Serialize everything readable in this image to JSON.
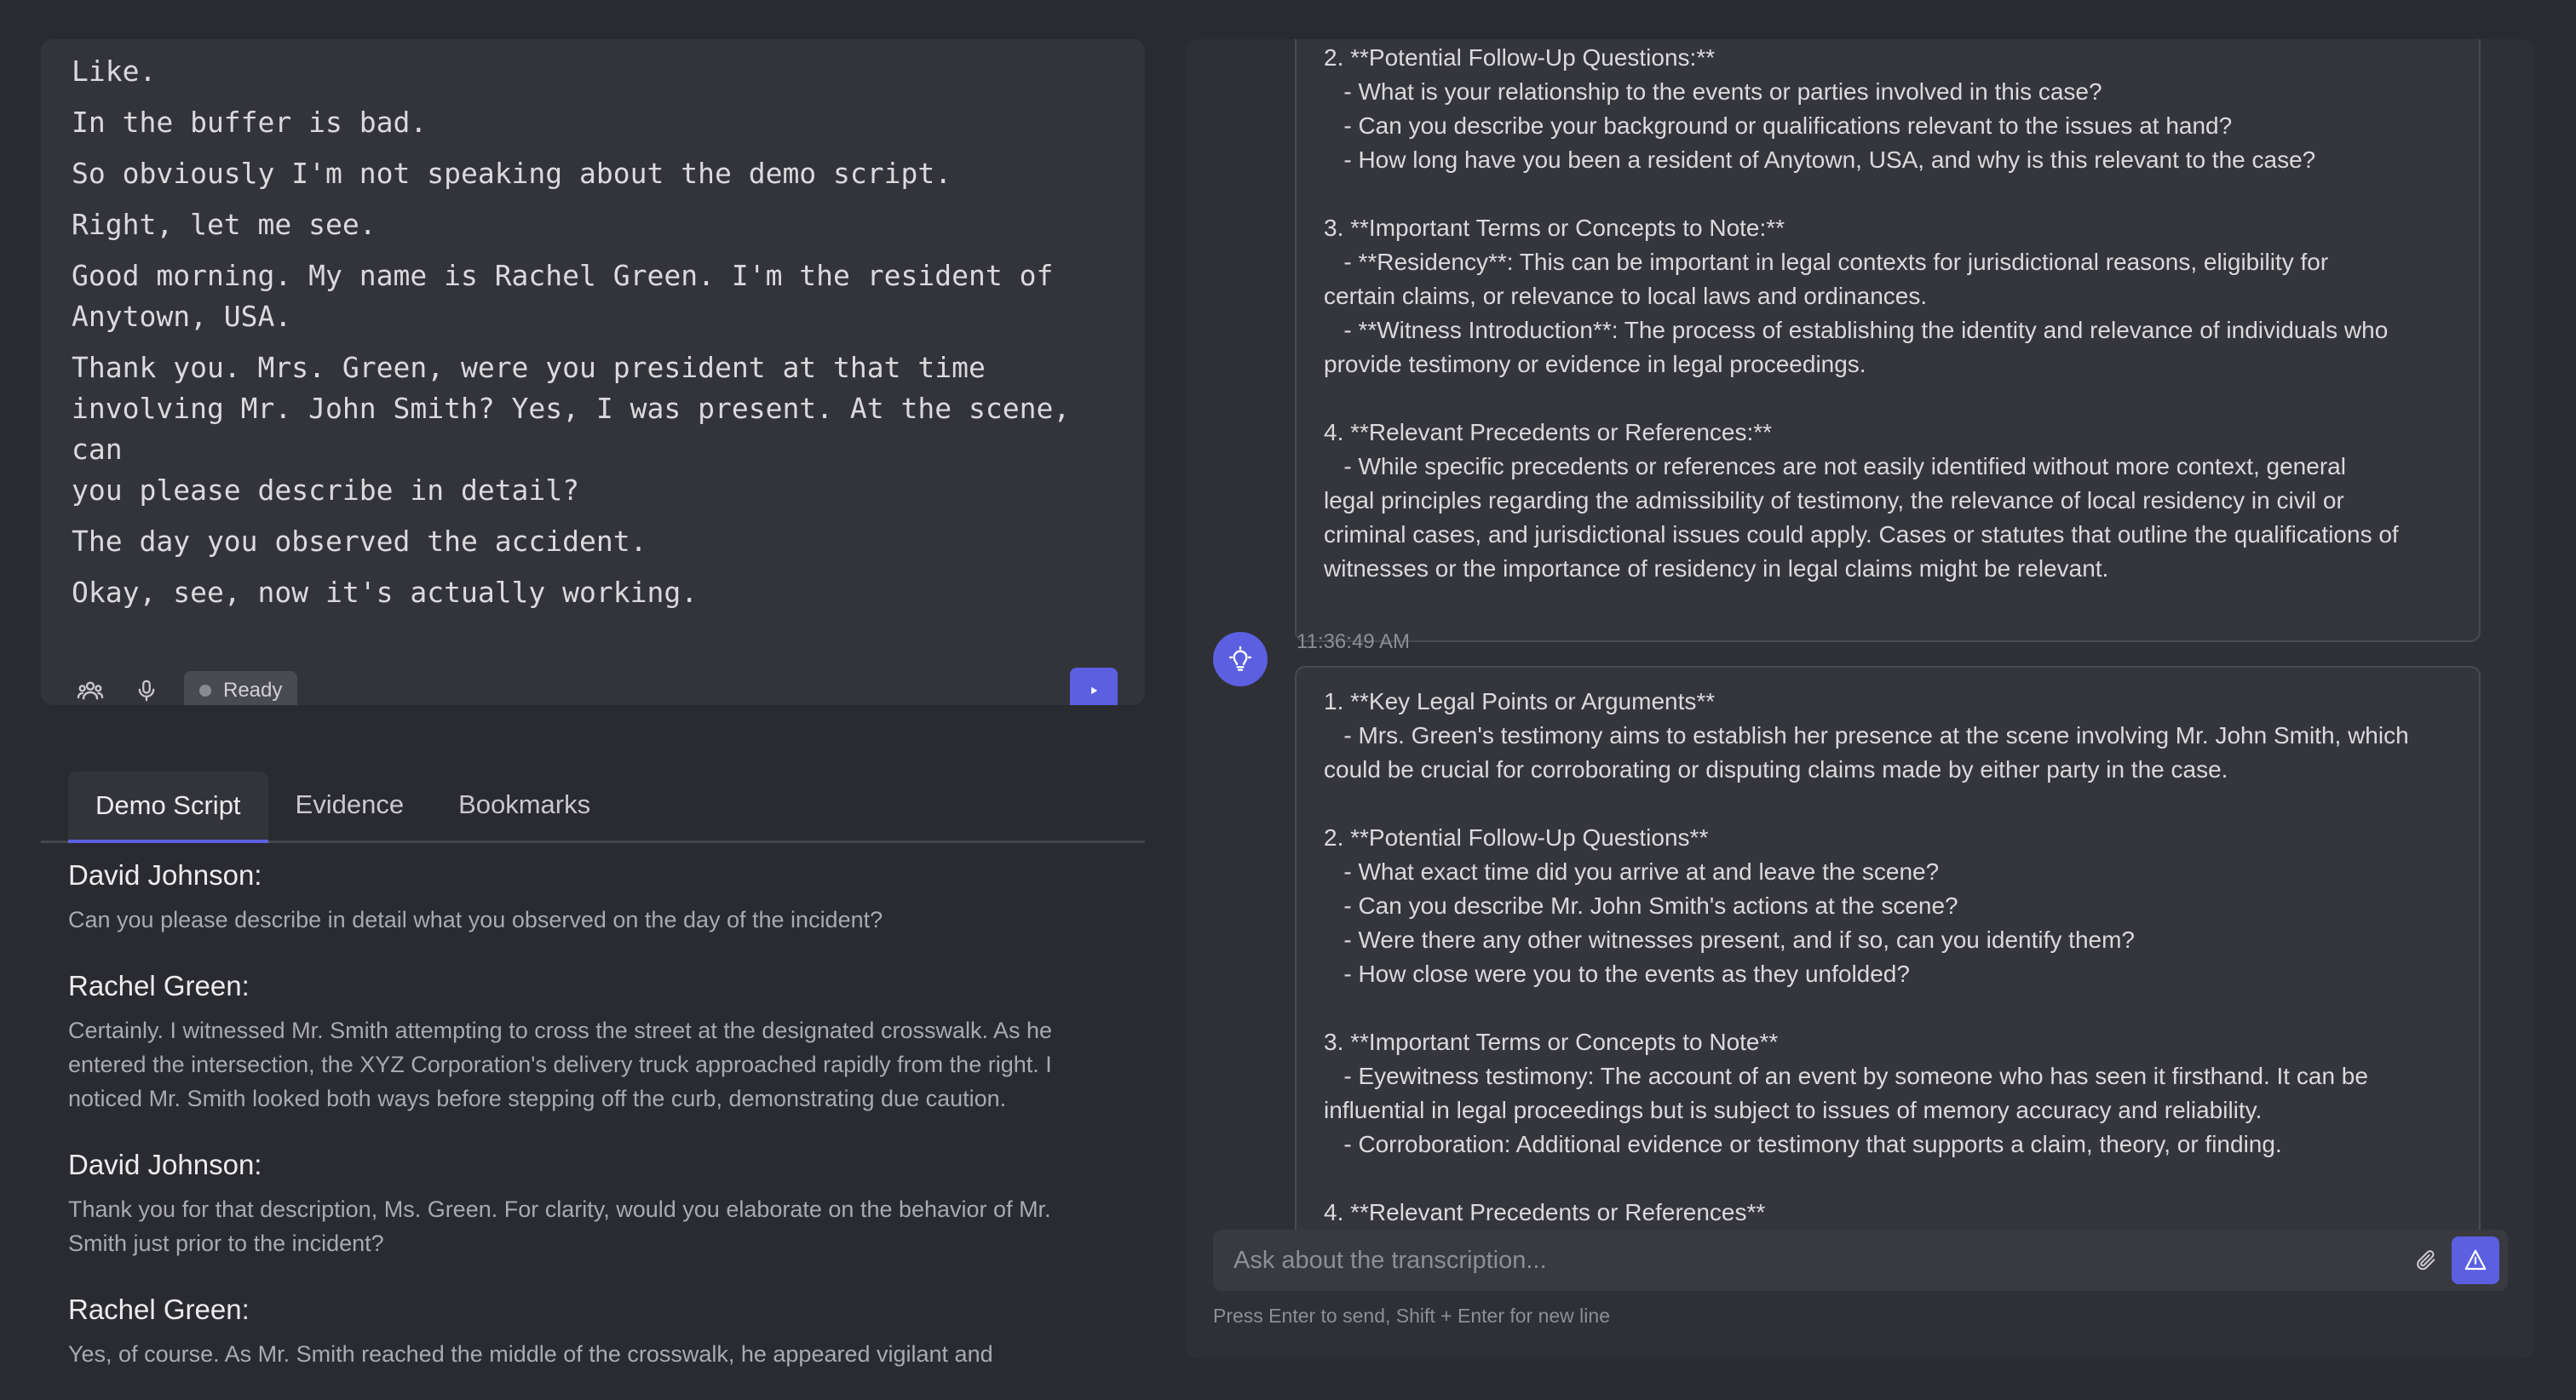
{
  "transcript": {
    "lines": [
      "Like.",
      "In the buffer is bad.",
      "So obviously I'm not speaking about the demo script.",
      "Right, let me see.",
      "Good morning. My name is Rachel Green. I'm the resident of\nAnytown, USA.",
      "Thank you. Mrs. Green, were you president at that time\ninvolving Mr. John Smith? Yes, I was present. At the scene, can\nyou please describe in detail?",
      "The day you observed the accident.",
      "Okay, see, now it's actually working."
    ],
    "status": "Ready",
    "icons": {
      "speakers": "users-icon",
      "mic": "microphone-icon",
      "send": "play-icon"
    }
  },
  "tabs": [
    {
      "label": "Demo Script",
      "active": true
    },
    {
      "label": "Evidence",
      "active": false
    },
    {
      "label": "Bookmarks",
      "active": false
    }
  ],
  "script": [
    {
      "speaker": "David Johnson:",
      "text": "Can you please describe in detail what you observed on the day of the incident?"
    },
    {
      "speaker": "Rachel Green:",
      "text": "Certainly. I witnessed Mr. Smith attempting to cross the street at the designated crosswalk. As he entered the intersection, the XYZ Corporation's delivery truck approached rapidly from the right. I noticed Mr. Smith looked both ways before stepping off the curb, demonstrating due caution."
    },
    {
      "speaker": "David Johnson:",
      "text": "Thank you for that description, Ms. Green. For clarity, would you elaborate on the behavior of Mr. Smith just prior to the incident?"
    },
    {
      "speaker": "Rachel Green:",
      "text": "Yes, of course. As Mr. Smith reached the middle of the crosswalk, he appeared vigilant and"
    }
  ],
  "analysis": {
    "message1_lines": [
      "2. **Potential Follow-Up Questions:**",
      "   - What is your relationship to the events or parties involved in this case?",
      "   - Can you describe your background or qualifications relevant to the issues at hand?",
      "   - How long have you been a resident of Anytown, USA, and why is this relevant to the case?",
      "",
      "3. **Important Terms or Concepts to Note:**",
      "   - **Residency**: This can be important in legal contexts for jurisdictional reasons, eligibility for",
      "certain claims, or relevance to local laws and ordinances.",
      "   - **Witness Introduction**: The process of establishing the identity and relevance of individuals who",
      "provide testimony or evidence in legal proceedings.",
      "",
      "4. **Relevant Precedents or References:**",
      "   - While specific precedents or references are not easily identified without more context, general",
      "legal principles regarding the admissibility of testimony, the relevance of local residency in civil or",
      "criminal cases, and jurisdictional issues could apply. Cases or statutes that outline the qualifications of",
      "witnesses or the importance of residency in legal claims might be relevant."
    ],
    "message2_timestamp": "11:36:49 AM",
    "message2_lines": [
      "1. **Key Legal Points or Arguments**",
      "   - Mrs. Green's testimony aims to establish her presence at the scene involving Mr. John Smith, which",
      "could be crucial for corroborating or disputing claims made by either party in the case.",
      "",
      "2. **Potential Follow-Up Questions**",
      "   - What exact time did you arrive at and leave the scene?",
      "   - Can you describe Mr. John Smith's actions at the scene?",
      "   - Were there any other witnesses present, and if so, can you identify them?",
      "   - How close were you to the events as they unfolded?",
      "",
      "3. **Important Terms or Concepts to Note**",
      "   - Eyewitness testimony: The account of an event by someone who has seen it firsthand. It can be",
      "influential in legal proceedings but is subject to issues of memory accuracy and reliability.",
      "   - Corroboration: Additional evidence or testimony that supports a claim, theory, or finding.",
      "",
      "4. **Relevant Precedents or References**"
    ],
    "avatar_icon": "lightbulb-icon",
    "input_placeholder": "Ask about the transcription...",
    "hint": "Press Enter to send, Shift + Enter for new line",
    "icons": {
      "attach": "paperclip-icon",
      "send": "send-icon"
    }
  },
  "colors": {
    "accent": "#5b5fe0",
    "background": "#2a2b30",
    "panel": "#33343a"
  }
}
